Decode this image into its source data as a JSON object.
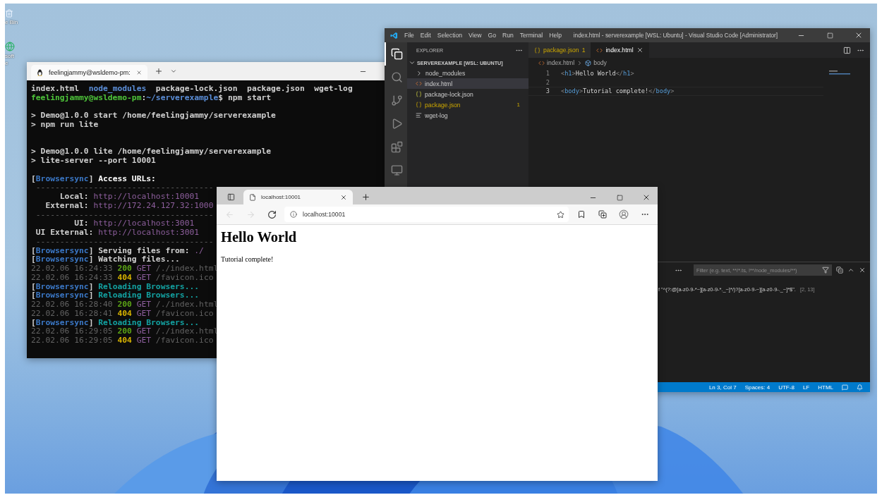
{
  "desktop": {
    "icons": [
      {
        "kind": "bin",
        "label": "e Bin"
      },
      {
        "kind": "browser",
        "label": "soft\ne"
      }
    ]
  },
  "terminal": {
    "tab": {
      "title": "feelingjammy@wsldemo-pm:"
    },
    "lines": [
      {
        "kind": "text",
        "segments": [
          {
            "kind": "plain",
            "text": "index.html  "
          },
          {
            "kind": "dir",
            "text": "node_modules"
          },
          {
            "kind": "plain",
            "text": "  package-lock.json  package.json  wget-log"
          }
        ]
      },
      {
        "kind": "text",
        "segments": [
          {
            "kind": "user",
            "text": "feelingjammy@wsldemo-pm"
          },
          {
            "kind": "plain",
            "text": ":"
          },
          {
            "kind": "dir",
            "text": "~/serverexample"
          },
          {
            "kind": "plain",
            "text": "$ npm start"
          }
        ]
      },
      {
        "kind": "blank"
      },
      {
        "kind": "text",
        "segments": [
          {
            "kind": "plain",
            "text": "> Demo@1.0.0 start /home/feelingjammy/serverexample"
          }
        ]
      },
      {
        "kind": "text",
        "segments": [
          {
            "kind": "plain",
            "text": "> npm run lite"
          }
        ]
      },
      {
        "kind": "blank"
      },
      {
        "kind": "blank"
      },
      {
        "kind": "text",
        "segments": [
          {
            "kind": "plain",
            "text": "> Demo@1.0.0 lite /home/feelingjammy/serverexample"
          }
        ]
      },
      {
        "kind": "text",
        "segments": [
          {
            "kind": "plain",
            "text": "> lite-server --port 10001"
          }
        ]
      },
      {
        "kind": "blank"
      },
      {
        "kind": "text",
        "segments": [
          {
            "kind": "plain",
            "text": "["
          },
          {
            "kind": "tag",
            "text": "Browsersync"
          },
          {
            "kind": "plain",
            "text": "] "
          },
          {
            "kind": "bold",
            "text": "Access URLs:"
          }
        ]
      },
      {
        "kind": "text",
        "segments": [
          {
            "kind": "dim",
            "text": " -------------------------------------"
          }
        ]
      },
      {
        "kind": "text",
        "segments": [
          {
            "kind": "plain",
            "text": "      Local: "
          },
          {
            "kind": "url",
            "text": "http://localhost:10001"
          }
        ]
      },
      {
        "kind": "text",
        "segments": [
          {
            "kind": "plain",
            "text": "   External: "
          },
          {
            "kind": "url",
            "text": "http://172.24.127.32:1000"
          }
        ]
      },
      {
        "kind": "text",
        "segments": [
          {
            "kind": "dim",
            "text": " -------------------------------------"
          }
        ]
      },
      {
        "kind": "text",
        "segments": [
          {
            "kind": "plain",
            "text": "         UI: "
          },
          {
            "kind": "url",
            "text": "http://localhost:3001"
          }
        ]
      },
      {
        "kind": "text",
        "segments": [
          {
            "kind": "plain",
            "text": " UI External: "
          },
          {
            "kind": "url",
            "text": "http://localhost:3001"
          }
        ]
      },
      {
        "kind": "text",
        "segments": [
          {
            "kind": "dim",
            "text": " -------------------------------------"
          }
        ]
      },
      {
        "kind": "text",
        "segments": [
          {
            "kind": "plain",
            "text": "["
          },
          {
            "kind": "tag",
            "text": "Browsersync"
          },
          {
            "kind": "plain",
            "text": "] Serving files from: "
          },
          {
            "kind": "url",
            "text": "./"
          }
        ]
      },
      {
        "kind": "text",
        "segments": [
          {
            "kind": "plain",
            "text": "["
          },
          {
            "kind": "tag",
            "text": "Browsersync"
          },
          {
            "kind": "plain",
            "text": "] Watching files..."
          }
        ]
      },
      {
        "kind": "text",
        "segments": [
          {
            "kind": "dim",
            "text": "22.02.06 16:24:33 "
          },
          {
            "kind": "ok",
            "text": "200"
          },
          {
            "kind": "url",
            "text": " GET"
          },
          {
            "kind": "dim",
            "text": " /./index.html"
          }
        ]
      },
      {
        "kind": "text",
        "segments": [
          {
            "kind": "dim",
            "text": "22.02.06 16:24:33 "
          },
          {
            "kind": "warn",
            "text": "404"
          },
          {
            "kind": "url",
            "text": " GET"
          },
          {
            "kind": "dim",
            "text": " /favicon.ico"
          }
        ]
      },
      {
        "kind": "text",
        "segments": [
          {
            "kind": "plain",
            "text": "["
          },
          {
            "kind": "tag",
            "text": "Browsersync"
          },
          {
            "kind": "plain",
            "text": "] "
          },
          {
            "kind": "reload",
            "text": "Reloading Browsers..."
          }
        ]
      },
      {
        "kind": "text",
        "segments": [
          {
            "kind": "plain",
            "text": "["
          },
          {
            "kind": "tag",
            "text": "Browsersync"
          },
          {
            "kind": "plain",
            "text": "] "
          },
          {
            "kind": "reload",
            "text": "Reloading Browsers..."
          }
        ]
      },
      {
        "kind": "text",
        "segments": [
          {
            "kind": "dim",
            "text": "22.02.06 16:28:40 "
          },
          {
            "kind": "ok",
            "text": "200"
          },
          {
            "kind": "url",
            "text": " GET"
          },
          {
            "kind": "dim",
            "text": " /./index.html"
          }
        ]
      },
      {
        "kind": "text",
        "segments": [
          {
            "kind": "dim",
            "text": "22.02.06 16:28:41 "
          },
          {
            "kind": "warn",
            "text": "404"
          },
          {
            "kind": "url",
            "text": " GET"
          },
          {
            "kind": "dim",
            "text": " /favicon.ico"
          }
        ]
      },
      {
        "kind": "text",
        "segments": [
          {
            "kind": "plain",
            "text": "["
          },
          {
            "kind": "tag",
            "text": "Browsersync"
          },
          {
            "kind": "plain",
            "text": "] "
          },
          {
            "kind": "reload",
            "text": "Reloading Browsers..."
          }
        ]
      },
      {
        "kind": "text",
        "segments": [
          {
            "kind": "dim",
            "text": "22.02.06 16:29:05 "
          },
          {
            "kind": "ok",
            "text": "200"
          },
          {
            "kind": "url",
            "text": " GET"
          },
          {
            "kind": "dim",
            "text": " /./index.html"
          }
        ]
      },
      {
        "kind": "text",
        "segments": [
          {
            "kind": "dim",
            "text": "22.02.06 16:29:05 "
          },
          {
            "kind": "warn",
            "text": "404"
          },
          {
            "kind": "url",
            "text": " GET"
          },
          {
            "kind": "dim",
            "text": " /favicon.ico"
          }
        ]
      }
    ]
  },
  "vscode": {
    "menu": [
      "File",
      "Edit",
      "Selection",
      "View",
      "Go",
      "Run",
      "Terminal",
      "Help"
    ],
    "title": "index.html - serverexample [WSL: Ubuntu] - Visual Studio Code [Administrator]",
    "activity": [
      {
        "kind": "files",
        "selected": true
      },
      {
        "kind": "search",
        "selected": false
      },
      {
        "kind": "source",
        "selected": false
      },
      {
        "kind": "run",
        "selected": false
      },
      {
        "kind": "extensions",
        "selected": false
      },
      {
        "kind": "remote",
        "selected": false
      }
    ],
    "sidebar": {
      "title": "EXPLORER",
      "folder": "SERVEREXAMPLE [WSL: UBUNTU]",
      "items": [
        {
          "kind": "folder",
          "label": "node_modules",
          "selected": false,
          "warning": false
        },
        {
          "kind": "html",
          "label": "index.html",
          "selected": true,
          "warning": false
        },
        {
          "kind": "json",
          "label": "package-lock.json",
          "selected": false,
          "warning": false
        },
        {
          "kind": "json",
          "label": "package.json",
          "selected": false,
          "warning": true,
          "badge": "1"
        },
        {
          "kind": "text",
          "label": "wget-log",
          "selected": false,
          "warning": false
        }
      ]
    },
    "tabs": [
      {
        "kind": "json",
        "label": "package.json",
        "badge": "1",
        "warning": true,
        "selected": false
      },
      {
        "kind": "html",
        "label": "index.html",
        "warning": false,
        "selected": true
      }
    ],
    "breadcrumb": [
      "index.html",
      "body"
    ],
    "code": [
      {
        "number": "1",
        "current": false,
        "segments": [
          {
            "kind": "punct",
            "text": "<"
          },
          {
            "kind": "tag",
            "text": "h1"
          },
          {
            "kind": "punct",
            "text": ">"
          },
          {
            "kind": "text",
            "text": "Hello World"
          },
          {
            "kind": "punct",
            "text": "</"
          },
          {
            "kind": "tag",
            "text": "h1"
          },
          {
            "kind": "punct",
            "text": ">"
          }
        ]
      },
      {
        "number": "2",
        "current": false
      },
      {
        "number": "3",
        "current": true,
        "segments": [
          {
            "kind": "punct",
            "text": "<"
          },
          {
            "kind": "tag",
            "text": "body"
          },
          {
            "kind": "punct",
            "text": ">"
          },
          {
            "kind": "text",
            "text": "Tutorial complete!"
          },
          {
            "kind": "punct",
            "text": "</"
          },
          {
            "kind": "tag",
            "text": "body"
          },
          {
            "kind": "punct",
            "text": ">"
          }
        ]
      }
    ],
    "panel": {
      "filter": {
        "placeholder": "Filter (e.g. text, **/*.ts, !**/node_modules/**)"
      },
      "problem": {
        "message": "f \"^(?:@[a-z0-9-*~][a-z0-9-*._~]*/)?[a-z0-9-~][a-z0-9-._~]*$\".",
        "location": "[2, 13]"
      }
    },
    "status": [
      "Ln 3, Col 7",
      "Spaces: 4",
      "UTF-8",
      "LF",
      "HTML"
    ]
  },
  "browser": {
    "tab": {
      "title": "localhost:10001"
    },
    "nav": [
      {
        "kind": "back",
        "disabled": true
      },
      {
        "kind": "forward",
        "disabled": true
      },
      {
        "kind": "reload",
        "disabled": false
      }
    ],
    "address": {
      "value": "localhost:10001"
    },
    "page": {
      "heading": "Hello World",
      "text": "Tutorial complete!"
    }
  }
}
